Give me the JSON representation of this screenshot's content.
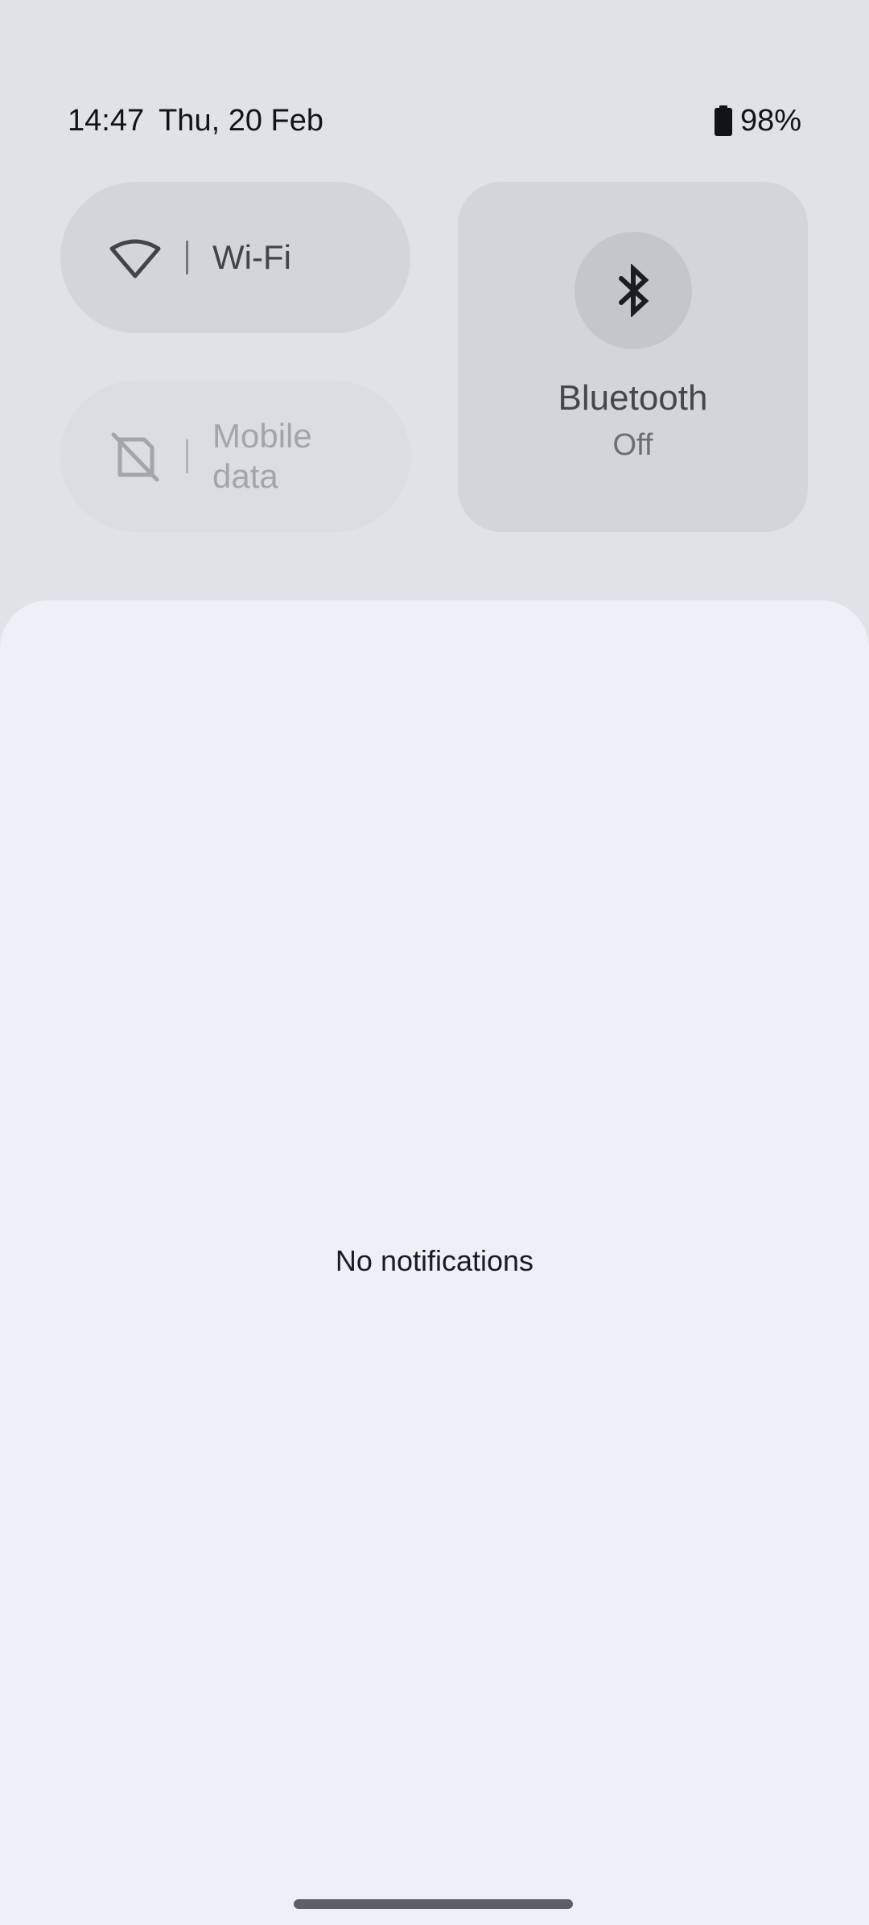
{
  "status_bar": {
    "time": "14:47",
    "date": "Thu, 20 Feb",
    "battery": "98%",
    "battery_icon": "battery-full-icon"
  },
  "quick_settings": {
    "wifi": {
      "label": "Wi-Fi",
      "icon": "wifi-icon"
    },
    "mobile_data": {
      "label": "Mobile data",
      "icon": "mobile-data-off-icon",
      "disabled": true
    },
    "bluetooth": {
      "label": "Bluetooth",
      "state": "Off",
      "icon": "bluetooth-icon"
    }
  },
  "notifications": {
    "empty_text": "No notifications"
  },
  "colors": {
    "shade_background": "#e1e2e7",
    "tile_background": "#d4d5db",
    "panel_background": "#efeff8",
    "text_primary": "#111318"
  }
}
